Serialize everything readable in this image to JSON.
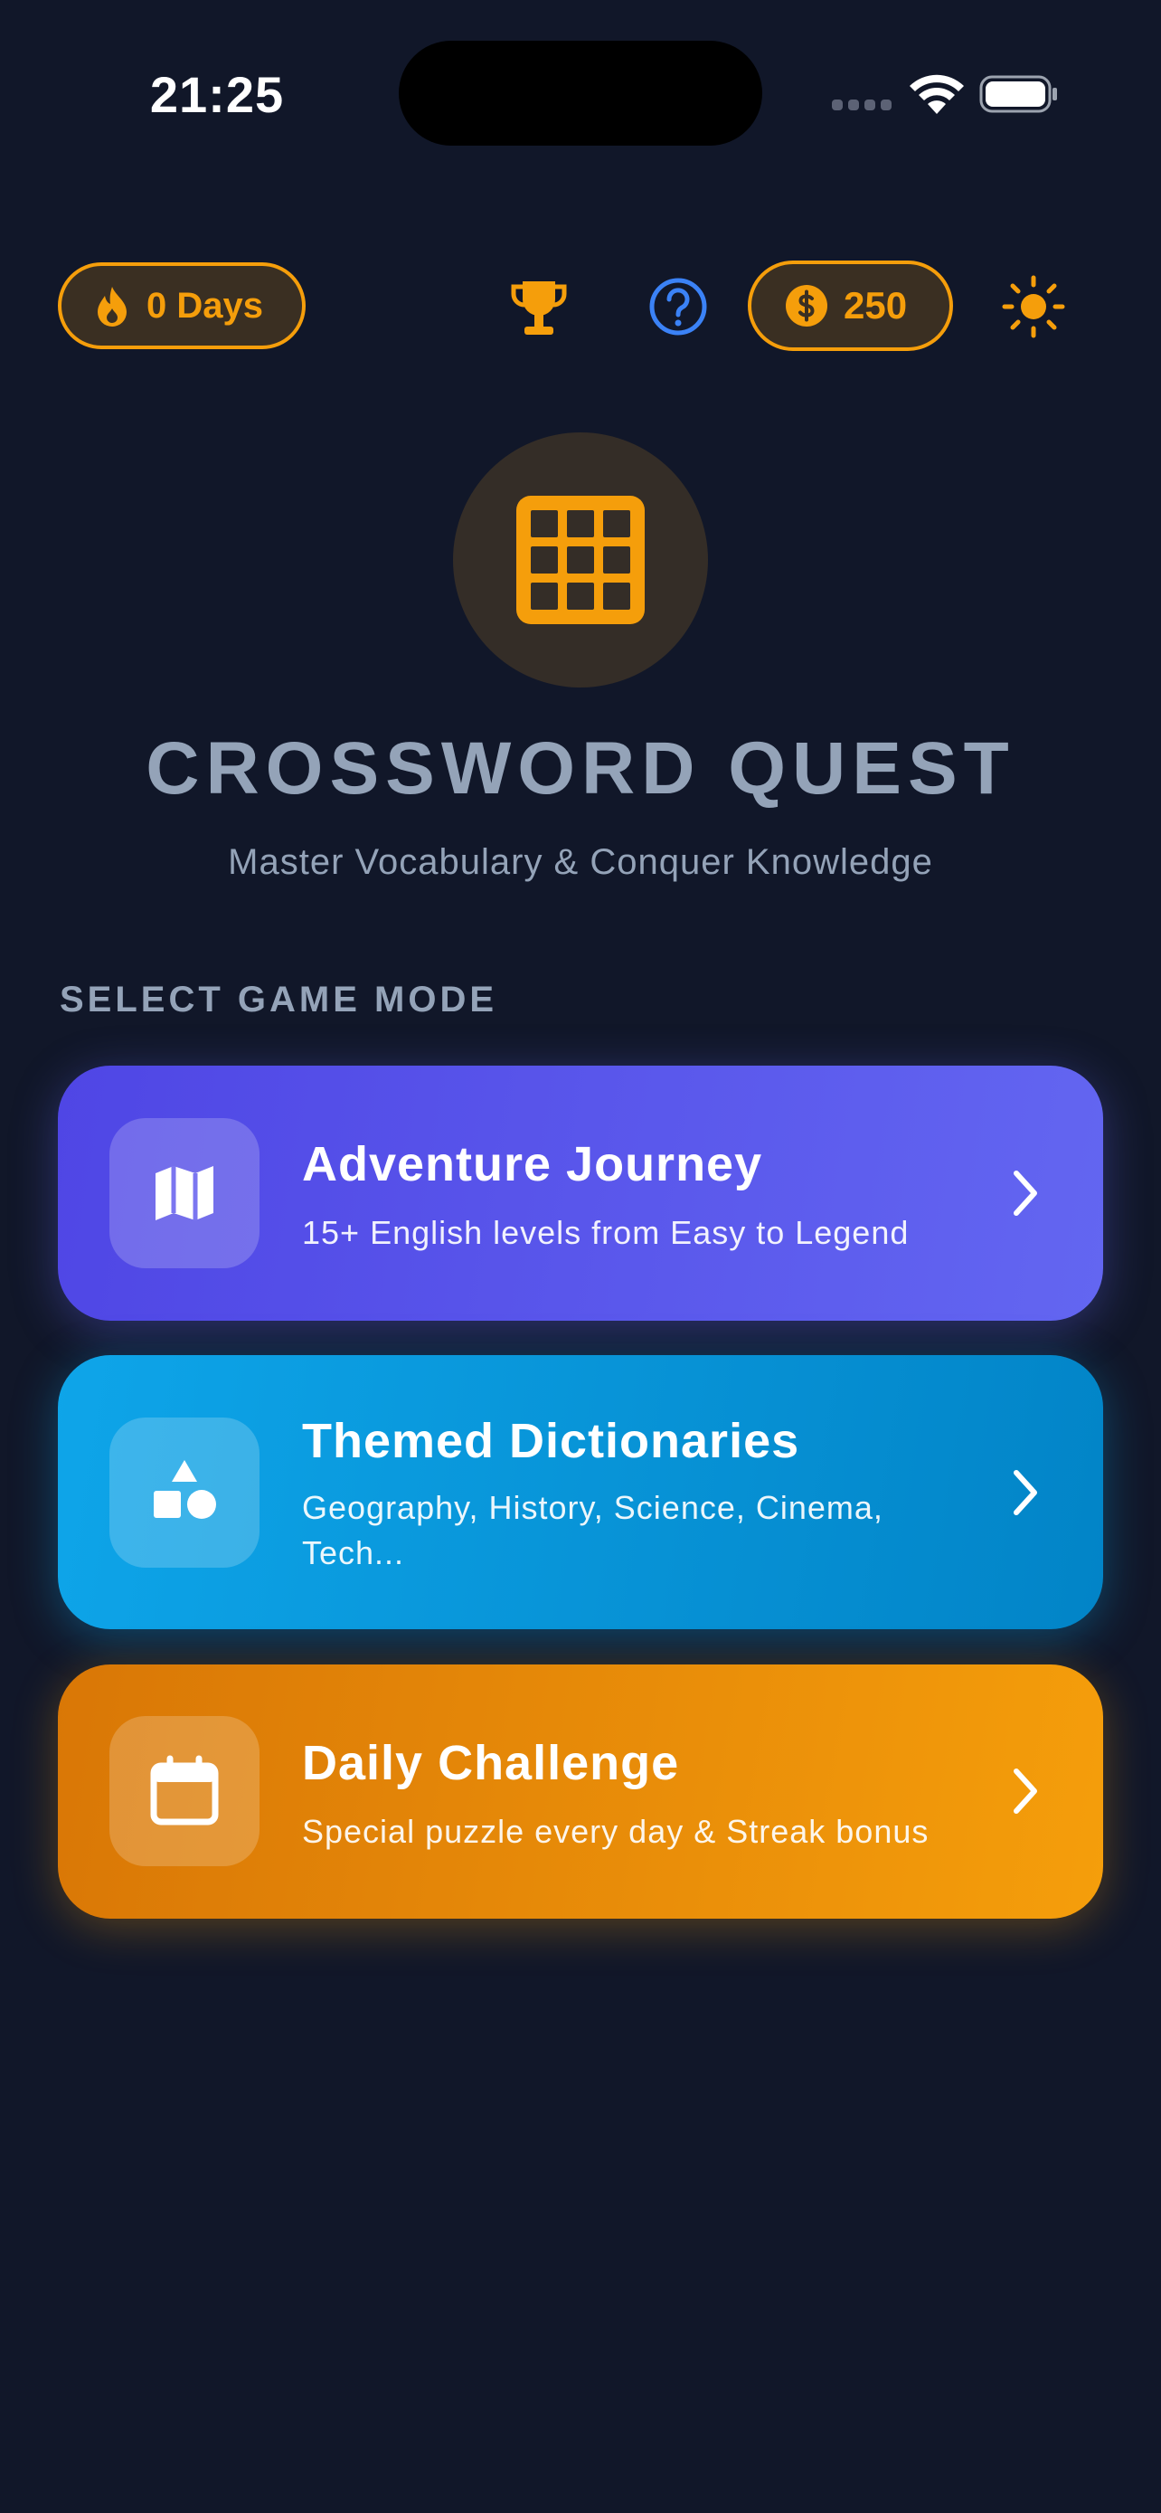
{
  "status_bar": {
    "time": "21:25"
  },
  "top_bar": {
    "streak_label": "0 Days",
    "coins": "250"
  },
  "hero": {
    "title": "CROSSWORD QUEST",
    "subtitle": "Master Vocabulary & Conquer Knowledge"
  },
  "section_label": "SELECT GAME MODE",
  "modes": [
    {
      "title": "Adventure Journey",
      "description": "15+ English levels from Easy to Legend",
      "icon": "map-icon",
      "color": "#5b55ec"
    },
    {
      "title": "Themed Dictionaries",
      "description": "Geography, History, Science, Cinema, Tech...",
      "icon": "shapes-icon",
      "color": "#0b9ade"
    },
    {
      "title": "Daily Challenge",
      "description": "Special puzzle every day & Streak bonus",
      "icon": "calendar-icon",
      "color": "#eb8f0c"
    }
  ],
  "colors": {
    "background": "#111729",
    "accent": "#f59e0b",
    "help_blue": "#3b82f6",
    "muted_text": "#94a3b8"
  }
}
